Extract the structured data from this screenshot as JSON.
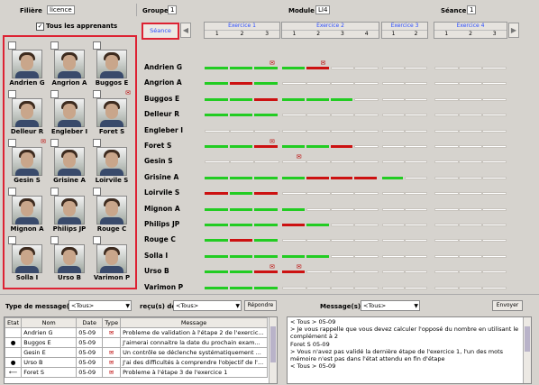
{
  "top": {
    "filiere_label": "Filière",
    "filiere_value": "licence",
    "groupe_label": "Groupe",
    "groupe_value": "1",
    "module_label": "Module",
    "module_value": "LI4",
    "seance_label": "Séance",
    "seance_value": "1",
    "tous_label": "Tous les apprenants",
    "seance_button": "Séance"
  },
  "exercises": [
    {
      "label": "Exercice 1",
      "steps": [
        "1",
        "2",
        "3"
      ]
    },
    {
      "label": "Exercice 2",
      "steps": [
        "1",
        "2",
        "3",
        "4"
      ]
    },
    {
      "label": "Exercice 3",
      "steps": [
        "1",
        "2"
      ]
    },
    {
      "label": "Exercice 4",
      "steps": [
        "1",
        "2",
        "3"
      ]
    }
  ],
  "students": [
    {
      "name": "Andrien G",
      "msg": false
    },
    {
      "name": "Angrion A",
      "msg": false
    },
    {
      "name": "Buggos E",
      "msg": false
    },
    {
      "name": "Delleur R",
      "msg": false
    },
    {
      "name": "Engleber I",
      "msg": false
    },
    {
      "name": "Foret S",
      "msg": true
    },
    {
      "name": "Gesin S",
      "msg": true
    },
    {
      "name": "Grisine A",
      "msg": false
    },
    {
      "name": "Loirvile S",
      "msg": false
    },
    {
      "name": "Mignon A",
      "msg": false
    },
    {
      "name": "Philips JP",
      "msg": false
    },
    {
      "name": "Rouge C",
      "msg": false
    },
    {
      "name": "Solla I",
      "msg": false
    },
    {
      "name": "Urso B",
      "msg": false
    },
    {
      "name": "Varimon P",
      "msg": false
    }
  ],
  "rows": [
    "Andrien G",
    "Angrion A",
    "Buggos E",
    "Delleur R",
    "Engleber I",
    "Foret S",
    "Gesin S",
    "Grisine A",
    "Loirvile S",
    "Mignon A",
    "Philips JP",
    "Rouge C",
    "Solla I",
    "Urso B",
    "Varimon P"
  ],
  "progress": [
    [
      "g",
      "g",
      "g",
      "g",
      "r",
      "",
      ""
    ],
    [
      "g",
      "r",
      "g",
      "",
      "",
      "",
      ""
    ],
    [
      "g",
      "g",
      "r",
      "g",
      "g",
      "g",
      ""
    ],
    [
      "g",
      "g",
      "g",
      "",
      "",
      "",
      ""
    ],
    [
      "",
      "",
      "",
      "",
      "",
      "",
      ""
    ],
    [
      "g",
      "g",
      "r",
      "g",
      "g",
      "r",
      ""
    ],
    [
      "",
      "",
      "",
      "",
      "",
      "",
      ""
    ],
    [
      "g",
      "g",
      "g",
      "g",
      "r",
      "r",
      "r",
      "g"
    ],
    [
      "r",
      "g",
      "r",
      "",
      "",
      "",
      ""
    ],
    [
      "g",
      "g",
      "g",
      "g",
      "",
      "",
      ""
    ],
    [
      "g",
      "g",
      "g",
      "r",
      "g",
      "",
      ""
    ],
    [
      "g",
      "r",
      "g",
      "",
      "",
      "",
      ""
    ],
    [
      "g",
      "g",
      "g",
      "g",
      "g",
      "",
      ""
    ],
    [
      "g",
      "g",
      "r",
      "r",
      "",
      "",
      ""
    ],
    [
      "g",
      "g",
      "g",
      "",
      "",
      "",
      ""
    ]
  ],
  "progress_msg_icons": [
    [
      0,
      2
    ],
    [
      0,
      4
    ],
    [
      5,
      2
    ],
    [
      6,
      3
    ],
    [
      13,
      2
    ],
    [
      13,
      3
    ]
  ],
  "bottom": {
    "type_label": "Type de message(s)",
    "type_value": "<Tous>",
    "recu_label": "reçu(s) de",
    "recu_value": "<Tous>",
    "repondre": "Répondre",
    "msgto_label": "Message(s) à",
    "msgto_value": "<Tous>",
    "envoyer": "Envoyer",
    "table_headers": [
      "Etat",
      "Nom",
      "Date",
      "Type",
      "Message"
    ],
    "table_rows": [
      {
        "etat": "",
        "nom": "Andrien G",
        "date": "05-09",
        "type": "m",
        "message": "Probleme de validation à l'étape 2 de l'exercic..."
      },
      {
        "etat": "dot",
        "nom": "Buggos E",
        "date": "05-09",
        "type": "",
        "message": "J'aimerai connaitre la date du prochain exam..."
      },
      {
        "etat": "",
        "nom": "Gesin E",
        "date": "05-09",
        "type": "m",
        "message": "Un contrôle se déclenche systématiquement ..."
      },
      {
        "etat": "dot",
        "nom": "Urso B",
        "date": "05-09",
        "type": "m",
        "message": "J'ai des difficultés à comprendre l'objectif de l'..."
      },
      {
        "etat": "arrow",
        "nom": "Foret S",
        "date": "05-09",
        "type": "m",
        "message": "Probleme à l'étape 3 de l'exercice 1"
      }
    ],
    "log_lines": [
      "< Tous > 05-09",
      "> Je vous rappelle que vous devez calculer l'opposé du nombre en utilisant le complément à 2",
      "Foret S 05-09",
      "> Vous n'avez pas validé la dernière étape de l'exercice 1, l'un des mots mémoire n'est pas dans l'état attendu en fin d'étape",
      "< Tous > 05-09"
    ]
  },
  "colors": {
    "green": "#22cc22",
    "red": "#cc1111",
    "empty": "#ffffff",
    "accent": "#d23"
  }
}
